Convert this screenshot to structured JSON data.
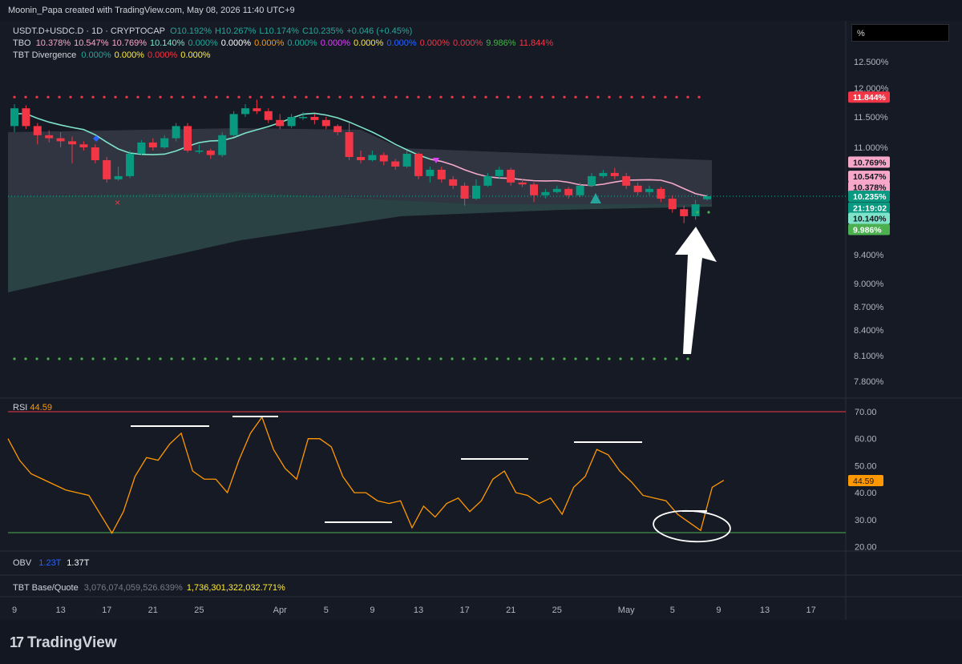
{
  "header": {
    "caption": "Moonin_Papa created with TradingView.com, May 08, 2026 11:40 UTC+9"
  },
  "scale_mode": "%",
  "legend": {
    "symbol": "USDT.D+USDC.D · 1D · CRYPTOCAP",
    "ohlc": [
      "O10.192%",
      "H10.267%",
      "L10.174%",
      "C10.235%",
      "+0.046 (+0.45%)"
    ],
    "tbo_label": "TBO",
    "tbo_values": [
      "10.378%",
      "10.547%",
      "10.769%",
      "10.140%",
      "0.000%",
      "0.000%",
      "0.000%",
      "0.000%",
      "0.000%",
      "0.000%",
      "0.000%",
      "0.000%",
      "0.000%",
      "9.986%",
      "11.844%"
    ],
    "tbo_colors": [
      "#f7a8c8",
      "#f7a8c8",
      "#f7a8c8",
      "#7ee3c8",
      "#26a69a",
      "#ffffff",
      "#ff9800",
      "#26a69a",
      "#e040fb",
      "#ffeb3b",
      "#2962ff",
      "#f23645",
      "#f23645",
      "#4caf50",
      "#f23645"
    ],
    "div_label": "TBT Divergence",
    "div_values": [
      "0.000%",
      "0.000%",
      "0.000%",
      "0.000%"
    ],
    "div_colors": [
      "#26a69a",
      "#ffeb3b",
      "#f23645",
      "#ffeb3b"
    ]
  },
  "rsi_legend": {
    "label": "RSI",
    "value": "44.59"
  },
  "obv_legend": {
    "label": "OBV",
    "v1": "1.23T",
    "v2": "1.37T"
  },
  "base_quote_legend": {
    "label": "TBT Base/Quote",
    "v1": "3,076,074,059,526.639%",
    "v2": "1,736,301,322,032.771%"
  },
  "price_badges": [
    {
      "text": "11.844%",
      "value": 11.844,
      "bg": "#f23645",
      "fg": "#ffffff"
    },
    {
      "text": "10.769%",
      "value": 10.769,
      "bg": "#f7a8c8",
      "fg": "#131722"
    },
    {
      "text": "10.547%",
      "value": 10.547,
      "bg": "#f7a8c8",
      "fg": "#131722"
    },
    {
      "text": "10.378%",
      "value": 10.378,
      "bg": "#f7a8c8",
      "fg": "#131722"
    },
    {
      "text": "10.235%",
      "value": 10.235,
      "bg": "#089981",
      "fg": "#ffffff"
    },
    {
      "text": "21:19:02",
      "value": 10.07,
      "bg": "#089981",
      "fg": "#ffffff"
    },
    {
      "text": "10.140%",
      "value": 9.92,
      "bg": "#7ee3c8",
      "fg": "#131722"
    },
    {
      "text": "9.986%",
      "value": 9.76,
      "bg": "#4caf50",
      "fg": "#ffffff"
    }
  ],
  "rsi_badge": {
    "text": "44.59",
    "bg": "#ff9800",
    "fg": "#131722"
  },
  "logo": {
    "mark": "17",
    "text": "TradingView"
  },
  "chart_data": [
    {
      "type": "candlestick",
      "title": "USDT.D+USDC.D · 1D · CRYPTOCAP",
      "y_unit": "%",
      "y_ticks": [
        "12.500%",
        "12.000%",
        "11.500%",
        "11.000%",
        "9.400%",
        "9.000%",
        "8.700%",
        "8.400%",
        "8.100%",
        "7.800%"
      ],
      "y_tick_values": [
        12.5,
        12.0,
        11.5,
        11.0,
        9.4,
        9.0,
        8.7,
        8.4,
        8.1,
        7.8
      ],
      "x_ticks": [
        "9",
        "13",
        "17",
        "21",
        "25",
        "Apr",
        "5",
        "9",
        "13",
        "17",
        "21",
        "25",
        "May",
        "5",
        "9",
        "13",
        "17"
      ],
      "x_tick_bars": [
        0,
        4,
        8,
        12,
        16,
        23,
        27,
        31,
        35,
        39,
        43,
        47,
        53,
        57,
        61,
        65,
        69
      ],
      "candles": [
        [
          11.35,
          11.65,
          11.72,
          11.25
        ],
        [
          11.65,
          11.35,
          11.7,
          11.3
        ],
        [
          11.35,
          11.2,
          11.4,
          11.05
        ],
        [
          11.2,
          11.15,
          11.28,
          11.08
        ],
        [
          11.15,
          11.1,
          11.25,
          11.0
        ],
        [
          11.1,
          11.05,
          11.18,
          10.75
        ],
        [
          11.05,
          11.0,
          11.1,
          10.95
        ],
        [
          11.0,
          10.8,
          11.05,
          10.75
        ],
        [
          10.8,
          10.5,
          10.85,
          10.45
        ],
        [
          10.5,
          10.55,
          10.7,
          10.48
        ],
        [
          10.55,
          10.9,
          10.95,
          10.52
        ],
        [
          10.9,
          11.08,
          11.12,
          10.88
        ],
        [
          11.08,
          11.0,
          11.15,
          10.95
        ],
        [
          11.0,
          11.15,
          11.2,
          10.98
        ],
        [
          11.15,
          11.35,
          11.4,
          11.1
        ],
        [
          11.35,
          10.95,
          11.4,
          10.92
        ],
        [
          10.95,
          10.95,
          11.05,
          10.9
        ],
        [
          10.95,
          10.88,
          10.98,
          10.82
        ],
        [
          10.88,
          11.2,
          11.25,
          10.85
        ],
        [
          11.2,
          11.55,
          11.6,
          11.18
        ],
        [
          11.55,
          11.65,
          11.72,
          11.5
        ],
        [
          11.65,
          11.6,
          11.8,
          11.55
        ],
        [
          11.6,
          11.45,
          11.65,
          11.4
        ],
        [
          11.45,
          11.35,
          11.55,
          11.3
        ],
        [
          11.35,
          11.5,
          11.55,
          11.32
        ],
        [
          11.5,
          11.5,
          11.58,
          11.45
        ],
        [
          11.5,
          11.45,
          11.55,
          11.38
        ],
        [
          11.45,
          11.35,
          11.5,
          11.3
        ],
        [
          11.35,
          11.25,
          11.38,
          11.2
        ],
        [
          11.25,
          10.85,
          11.4,
          10.8
        ],
        [
          10.85,
          10.8,
          10.95,
          10.75
        ],
        [
          10.8,
          10.88,
          10.95,
          10.78
        ],
        [
          10.88,
          10.78,
          10.92,
          10.72
        ],
        [
          10.78,
          10.7,
          10.82,
          10.65
        ],
        [
          10.7,
          10.9,
          10.95,
          10.68
        ],
        [
          10.9,
          10.55,
          10.92,
          10.5
        ],
        [
          10.55,
          10.65,
          10.7,
          10.45
        ],
        [
          10.65,
          10.5,
          10.7,
          10.45
        ],
        [
          10.5,
          10.4,
          10.55,
          10.35
        ],
        [
          10.4,
          10.2,
          10.45,
          10.1
        ],
        [
          10.2,
          10.4,
          10.5,
          10.18
        ],
        [
          10.4,
          10.55,
          10.6,
          10.38
        ],
        [
          10.55,
          10.65,
          10.7,
          10.5
        ],
        [
          10.65,
          10.45,
          10.68,
          10.4
        ],
        [
          10.45,
          10.42,
          10.5,
          10.38
        ],
        [
          10.42,
          10.25,
          10.45,
          10.15
        ],
        [
          10.25,
          10.3,
          10.35,
          10.2
        ],
        [
          10.3,
          10.35,
          10.4,
          10.28
        ],
        [
          10.35,
          10.25,
          10.38,
          10.2
        ],
        [
          10.25,
          10.4,
          10.45,
          10.22
        ],
        [
          10.4,
          10.55,
          10.6,
          10.38
        ],
        [
          10.55,
          10.6,
          10.65,
          10.52
        ],
        [
          10.6,
          10.55,
          10.68,
          10.5
        ],
        [
          10.55,
          10.4,
          10.6,
          10.35
        ],
        [
          10.4,
          10.3,
          10.45,
          10.25
        ],
        [
          10.3,
          10.35,
          10.4,
          10.25
        ],
        [
          10.35,
          10.2,
          10.38,
          10.15
        ],
        [
          10.2,
          10.05,
          10.25,
          10.0
        ],
        [
          10.05,
          9.95,
          10.1,
          9.85
        ],
        [
          9.95,
          10.12,
          10.18,
          9.9
        ],
        [
          10.192,
          10.235,
          10.267,
          10.174
        ]
      ],
      "tbo_levels": {
        "upper_dotted": 11.844,
        "lower_dotted": 8.05
      }
    },
    {
      "type": "line",
      "title": "RSI",
      "y_ticks": [
        "70.00",
        "60.00",
        "50.00",
        "40.00",
        "30.00",
        "20.00"
      ],
      "y_tick_values": [
        70,
        60,
        50,
        40,
        30,
        20
      ],
      "upper_band": 70,
      "lower_band": 25,
      "values": [
        60,
        52,
        47,
        45,
        43,
        41,
        40,
        39,
        32,
        25,
        33,
        46,
        53,
        52,
        58,
        62,
        48,
        45,
        45,
        40,
        52,
        62,
        68,
        56,
        49,
        45,
        60,
        60,
        57,
        46,
        40,
        40,
        37,
        36,
        37,
        27,
        35,
        31,
        36,
        38,
        33,
        37,
        45,
        48,
        40,
        39,
        36,
        38,
        32,
        42,
        46,
        56,
        54,
        48,
        44,
        39,
        38,
        37,
        32,
        29,
        26,
        42,
        44.59
      ]
    }
  ]
}
